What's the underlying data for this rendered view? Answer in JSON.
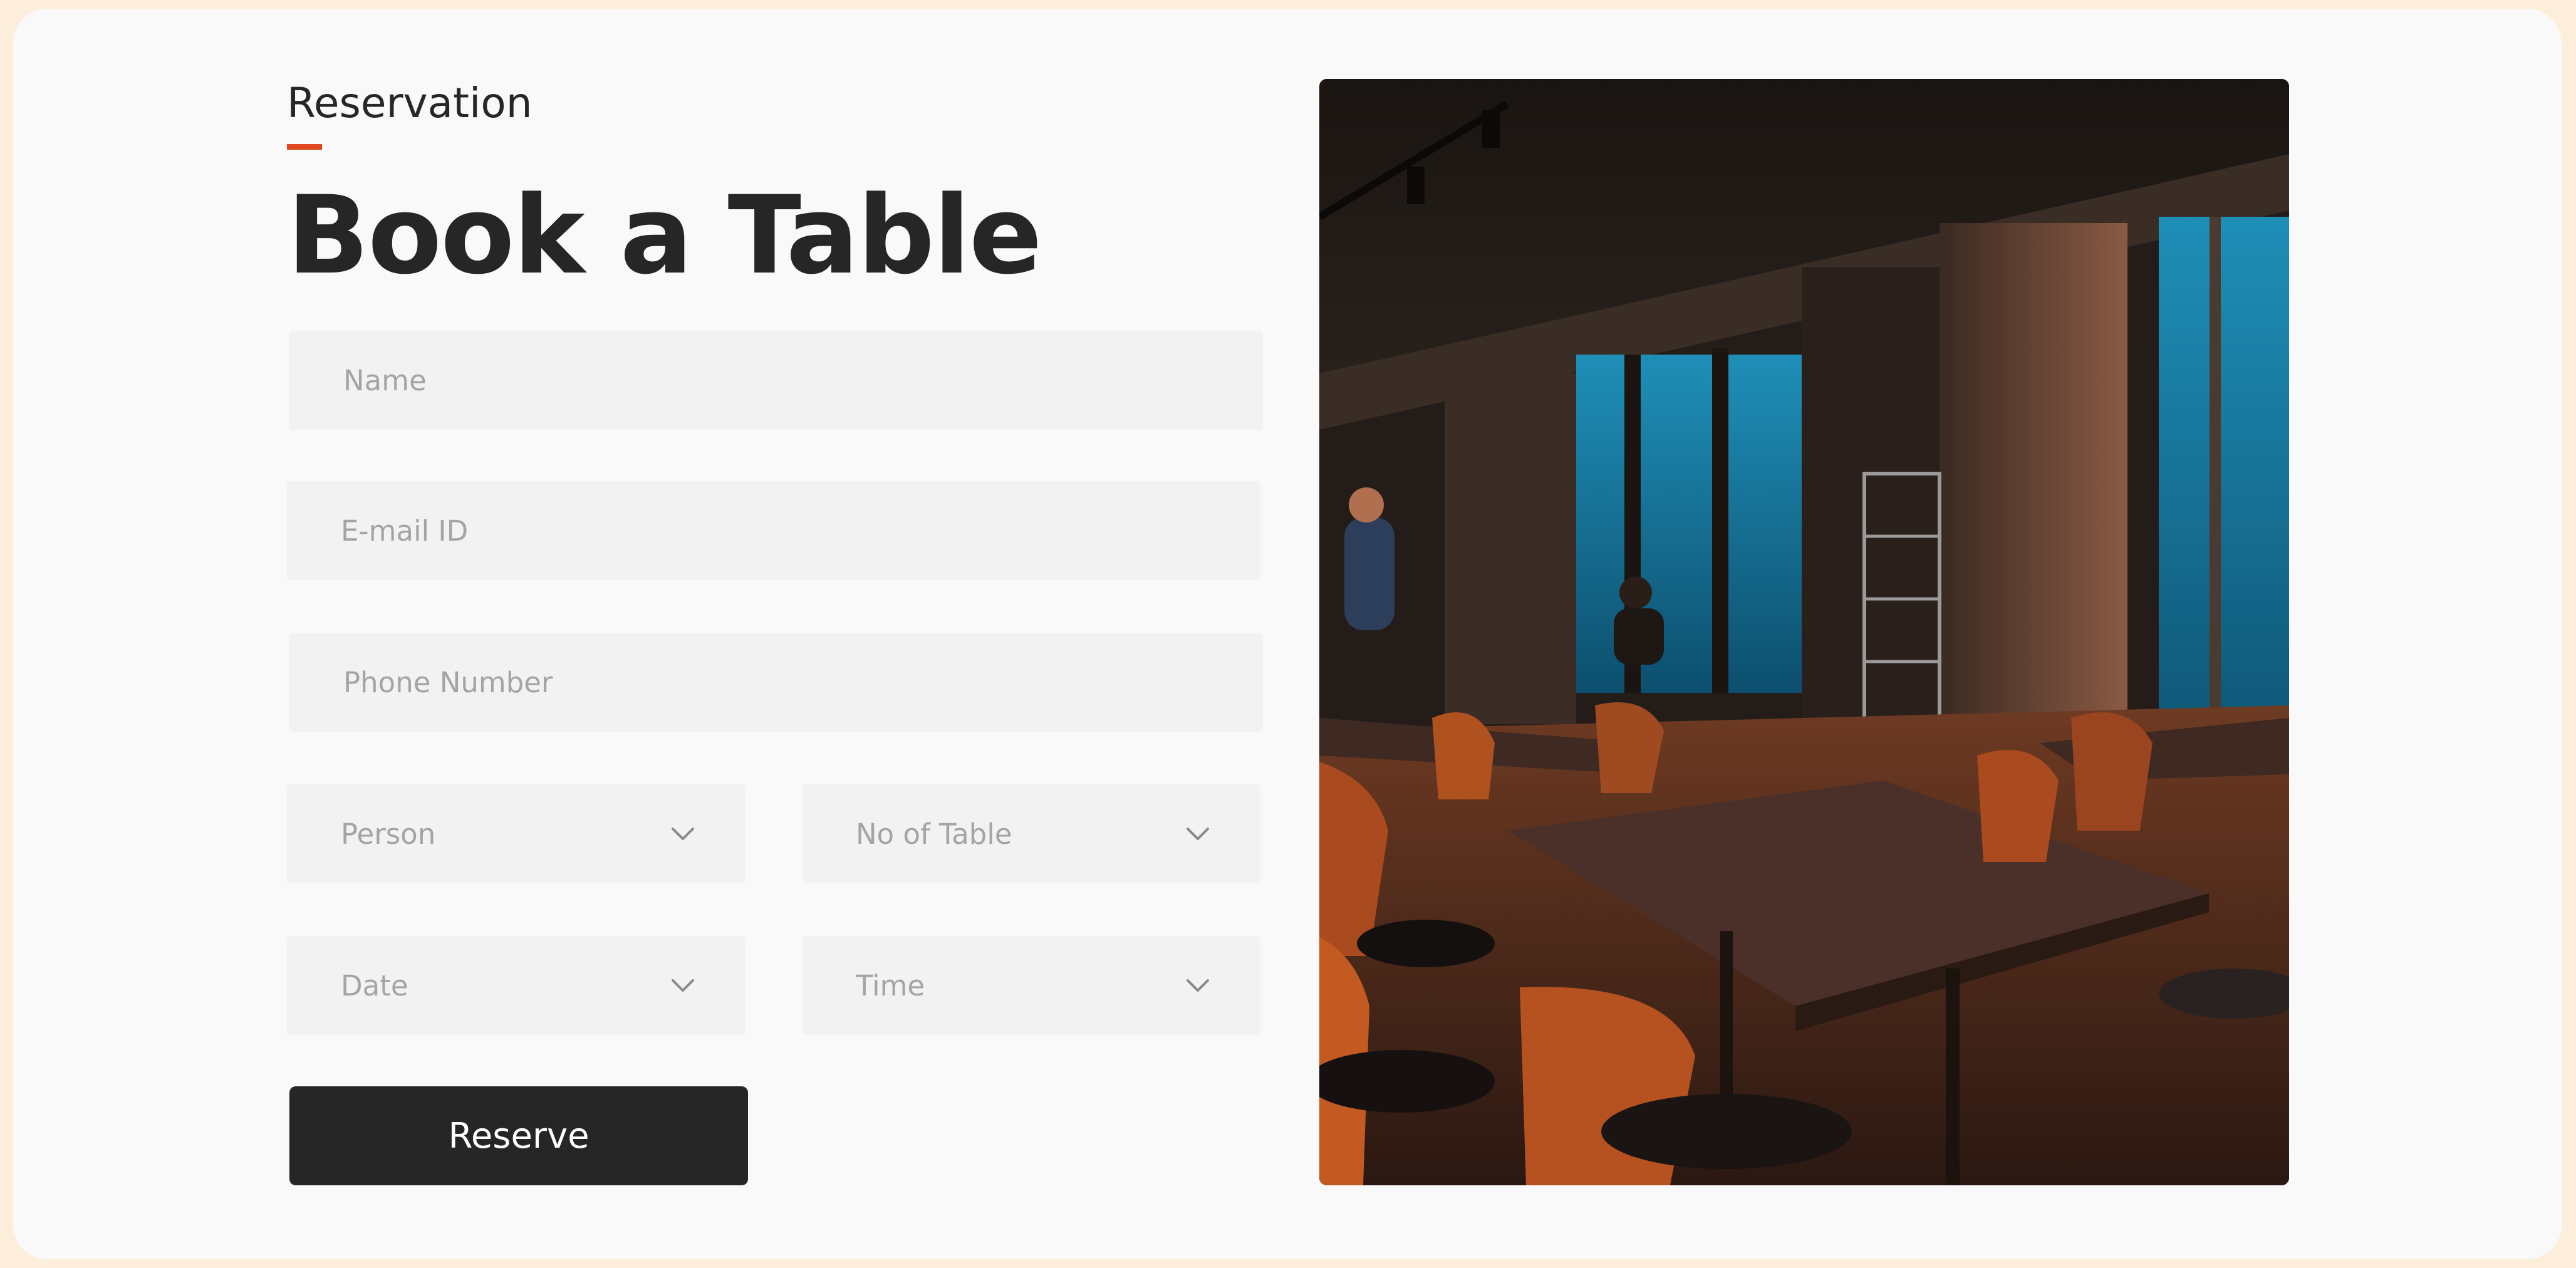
{
  "section": {
    "eyebrow": "Reservation",
    "accent_color": "#e0471f"
  },
  "heading": "Book a Table",
  "form": {
    "name_placeholder": "Name",
    "email_placeholder": "E-mail ID",
    "phone_placeholder": "Phone Number",
    "person_placeholder": "Person",
    "tables_placeholder": "No of Table",
    "date_placeholder": "Date",
    "time_placeholder": "Time",
    "submit_label": "Reserve"
  },
  "icons": {
    "dropdown": "chevron-down-icon"
  },
  "image": {
    "subject": "restaurant-interior-photo"
  }
}
